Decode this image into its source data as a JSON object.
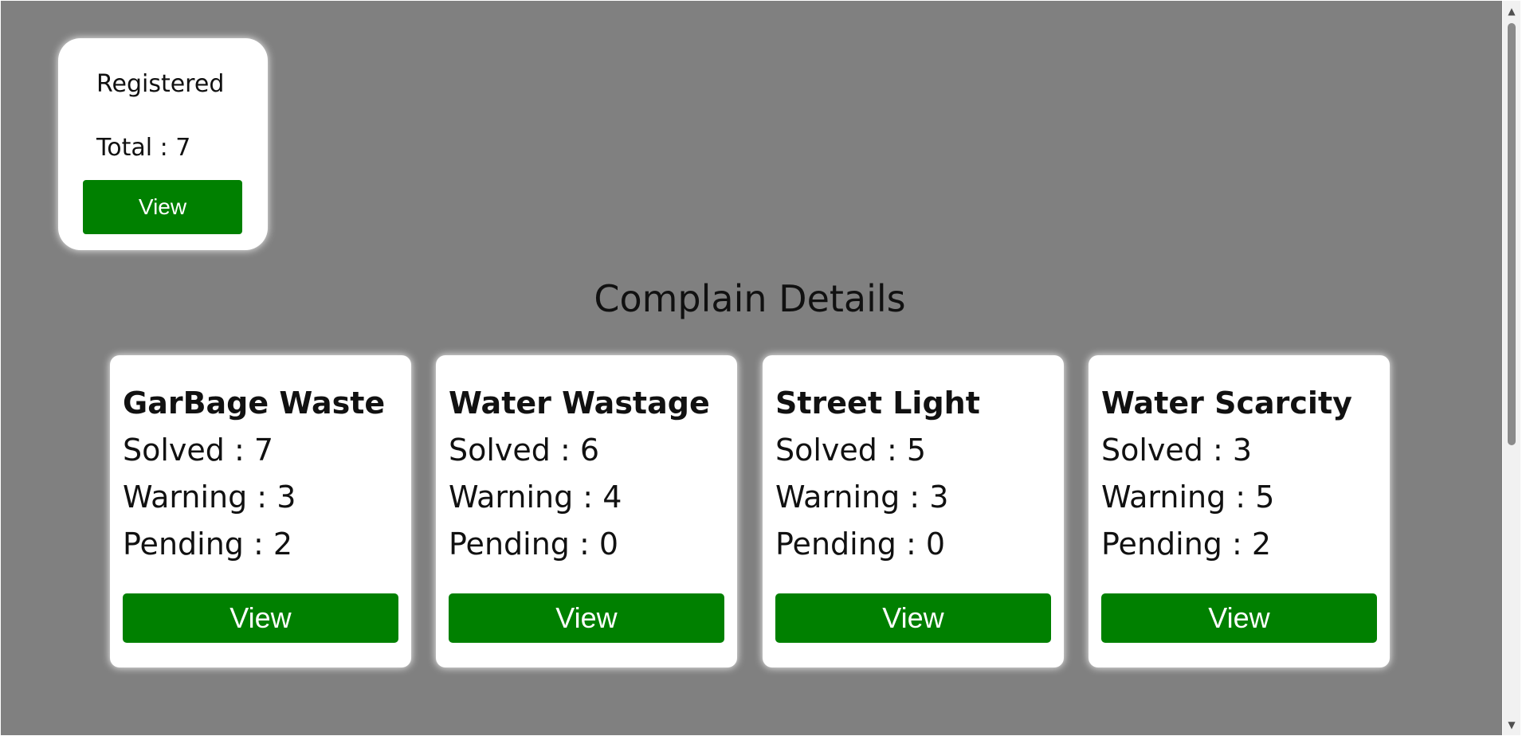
{
  "registered": {
    "title": "Registered",
    "total": "Total : 7",
    "view_label": "View"
  },
  "section": {
    "title": "Complain Details"
  },
  "cards": [
    {
      "title": "GarBage Waste",
      "solved": "Solved : 7",
      "warning": "Warning : 3",
      "pending": "Pending : 2",
      "view_label": "View"
    },
    {
      "title": "Water Wastage",
      "solved": "Solved : 6",
      "warning": "Warning : 4",
      "pending": "Pending : 0",
      "view_label": "View"
    },
    {
      "title": "Street Light",
      "solved": "Solved : 5",
      "warning": "Warning : 3",
      "pending": "Pending : 0",
      "view_label": "View"
    },
    {
      "title": "Water Scarcity",
      "solved": "Solved : 3",
      "warning": "Warning : 5",
      "pending": "Pending : 2",
      "view_label": "View"
    }
  ],
  "scrollbar": {
    "up_icon": "chevron-up-icon",
    "down_icon": "chevron-down-icon"
  },
  "colors": {
    "background": "#808080",
    "button": "#008000",
    "card": "#ffffff"
  }
}
